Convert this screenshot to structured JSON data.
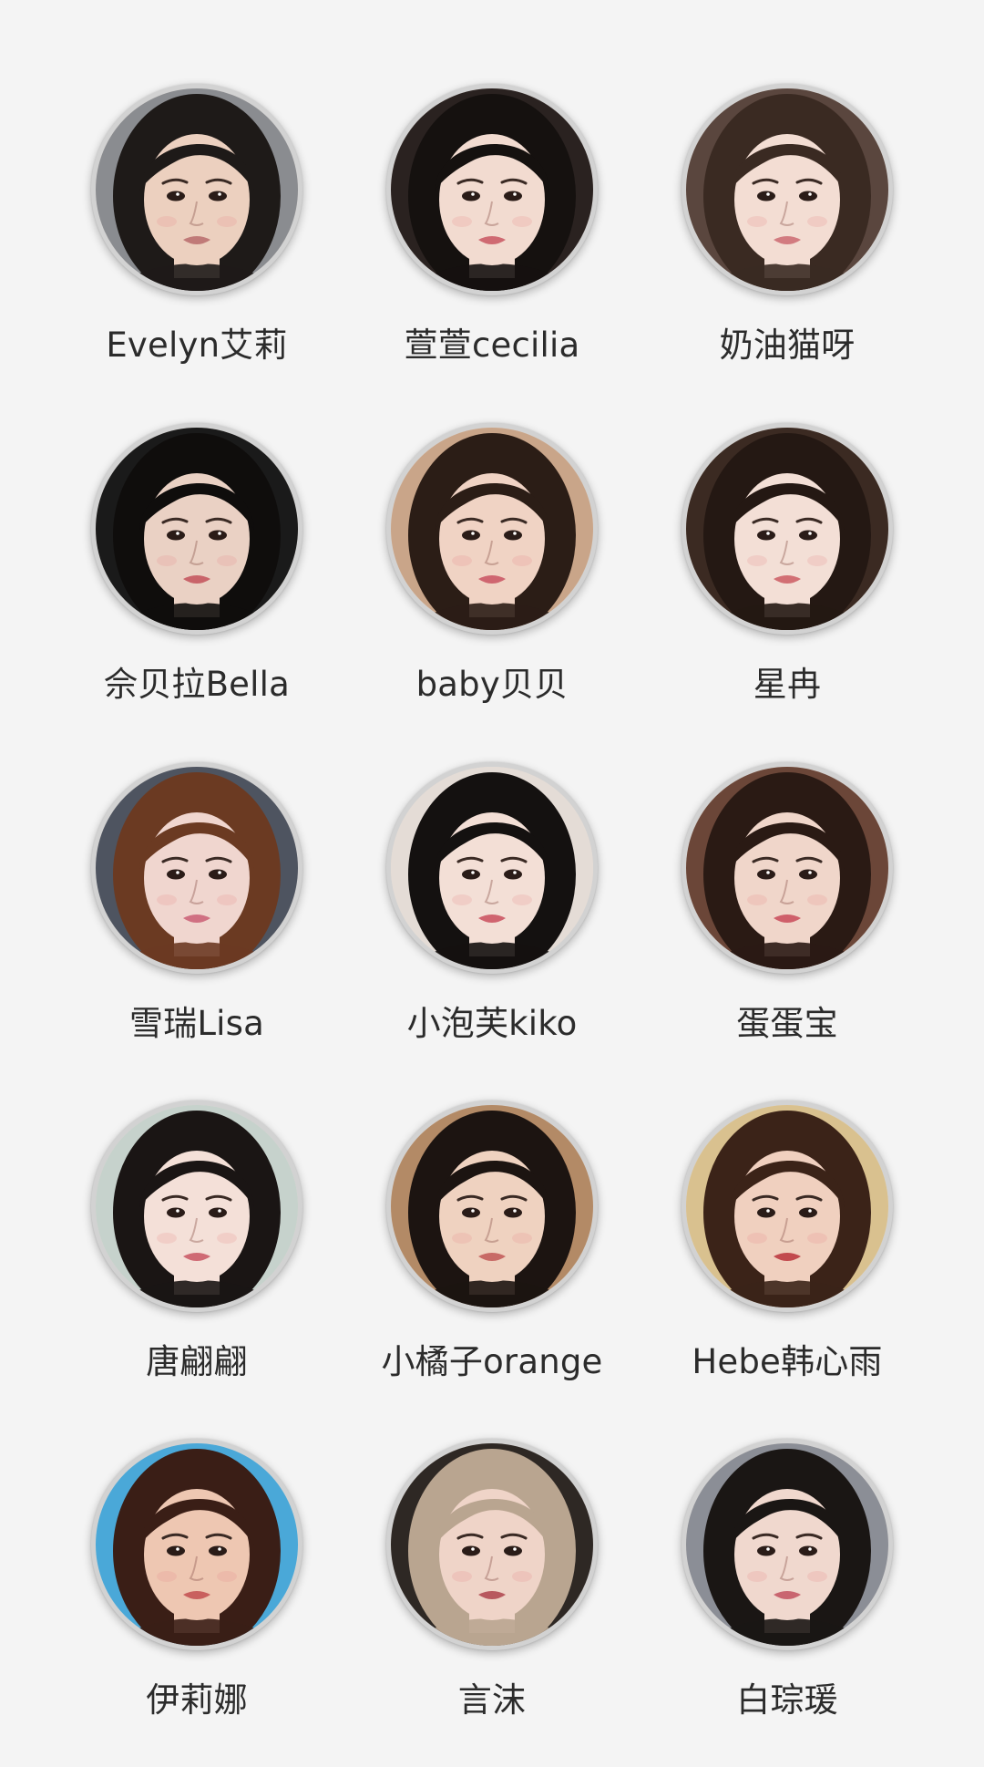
{
  "profiles": [
    {
      "name": "Evelyn艾莉",
      "bg": "#8a8c90",
      "hair": "#1e1a18",
      "skin": "#ecd0bf",
      "lips": "#c07a78"
    },
    {
      "name": "萱萱cecilia",
      "bg": "#2a2220",
      "hair": "#15110f",
      "skin": "#f2dbd0",
      "lips": "#cf6a72"
    },
    {
      "name": "奶油猫呀",
      "bg": "#5a463e",
      "hair": "#3a2a22",
      "skin": "#f3ddd3",
      "lips": "#d27b80"
    },
    {
      "name": "佘贝拉Bella",
      "bg": "#1a1a1a",
      "hair": "#0f0d0c",
      "skin": "#ead1c4",
      "lips": "#c9646a"
    },
    {
      "name": "baby贝贝",
      "bg": "#c9a589",
      "hair": "#2b1d16",
      "skin": "#f0d3c4",
      "lips": "#cf6670"
    },
    {
      "name": "星冉",
      "bg": "#3b2a22",
      "hair": "#241813",
      "skin": "#f3dfd6",
      "lips": "#d26f74"
    },
    {
      "name": "雪瑞Lisa",
      "bg": "#4e5460",
      "hair": "#6b3a22",
      "skin": "#f0d6cf",
      "lips": "#d07082"
    },
    {
      "name": "小泡芙kiko",
      "bg": "#e4dcd6",
      "hair": "#141110",
      "skin": "#f3dfd6",
      "lips": "#d0646f"
    },
    {
      "name": "蛋蛋宝",
      "bg": "#6b4638",
      "hair": "#2a1a14",
      "skin": "#f0d6ca",
      "lips": "#cf5f6a"
    },
    {
      "name": "唐翩翩",
      "bg": "#c6d2cc",
      "hair": "#1a1514",
      "skin": "#f4e0d8",
      "lips": "#cf6a74"
    },
    {
      "name": "小橘子orange",
      "bg": "#b38a66",
      "hair": "#1c1411",
      "skin": "#efd2c0",
      "lips": "#c86a66"
    },
    {
      "name": "Hebe韩心雨",
      "bg": "#d9c18f",
      "hair": "#3b2318",
      "skin": "#f0d0bf",
      "lips": "#c24a4e"
    },
    {
      "name": "伊莉娜",
      "bg": "#4aa8d8",
      "hair": "#3a1e16",
      "skin": "#eec7b2",
      "lips": "#c9605e"
    },
    {
      "name": "言沫",
      "bg": "#2e2824",
      "hair": "#b9a590",
      "skin": "#efd4c8",
      "lips": "#b8585e"
    },
    {
      "name": "白琮瑗",
      "bg": "#8b8e96",
      "hair": "#1a1614",
      "skin": "#f0d8ce",
      "lips": "#c96670"
    }
  ]
}
